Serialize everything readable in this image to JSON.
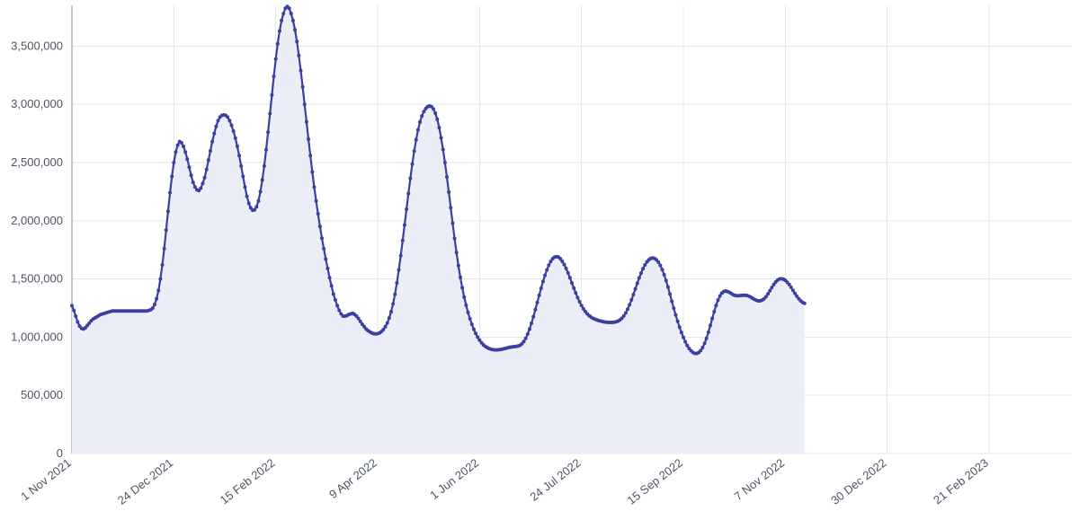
{
  "chart_data": {
    "type": "area",
    "title": "",
    "xlabel": "",
    "ylabel": "",
    "ylim": [
      0,
      3850000
    ],
    "y_ticks": [
      0,
      500000,
      1000000,
      1500000,
      2000000,
      2500000,
      3000000,
      3500000
    ],
    "y_tick_labels": [
      "0",
      "500,000",
      "1,000,000",
      "1,500,000",
      "2,000,000",
      "2,500,000",
      "3,000,000",
      "3,500,000"
    ],
    "x_tick_labels": [
      "1 Nov 2021",
      "24 Dec 2021",
      "15 Feb 2022",
      "9 Apr 2022",
      "1 Jun 2022",
      "24 Jul 2022",
      "15 Sep 2022",
      "7 Nov 2022",
      "30 Dec 2022",
      "21 Feb 2023"
    ],
    "x_tick_positions": [
      0,
      53,
      106,
      159,
      212,
      265,
      318,
      371,
      424,
      477
    ],
    "x_range": [
      0,
      520
    ],
    "line_color": "#3b3f9e",
    "fill_color": "#eceef7",
    "values": [
      1270000,
      1230000,
      1180000,
      1130000,
      1095000,
      1075000,
      1070000,
      1080000,
      1100000,
      1120000,
      1140000,
      1155000,
      1165000,
      1175000,
      1185000,
      1195000,
      1200000,
      1205000,
      1210000,
      1215000,
      1220000,
      1225000,
      1225000,
      1225000,
      1225000,
      1225000,
      1225000,
      1225000,
      1225000,
      1225000,
      1225000,
      1225000,
      1225000,
      1225000,
      1225000,
      1225000,
      1225000,
      1225000,
      1225000,
      1225000,
      1230000,
      1235000,
      1250000,
      1280000,
      1330000,
      1400000,
      1500000,
      1620000,
      1760000,
      1920000,
      2080000,
      2240000,
      2380000,
      2500000,
      2590000,
      2650000,
      2680000,
      2670000,
      2640000,
      2590000,
      2530000,
      2460000,
      2390000,
      2330000,
      2290000,
      2265000,
      2260000,
      2280000,
      2320000,
      2370000,
      2440000,
      2520000,
      2600000,
      2680000,
      2750000,
      2810000,
      2860000,
      2890000,
      2905000,
      2910000,
      2905000,
      2890000,
      2860000,
      2820000,
      2770000,
      2710000,
      2640000,
      2560000,
      2470000,
      2380000,
      2290000,
      2210000,
      2150000,
      2110000,
      2090000,
      2095000,
      2120000,
      2170000,
      2250000,
      2350000,
      2470000,
      2610000,
      2760000,
      2920000,
      3080000,
      3240000,
      3390000,
      3520000,
      3630000,
      3720000,
      3780000,
      3825000,
      3840000,
      3825000,
      3780000,
      3720000,
      3640000,
      3540000,
      3420000,
      3290000,
      3150000,
      3000000,
      2850000,
      2700000,
      2560000,
      2420000,
      2290000,
      2170000,
      2060000,
      1950000,
      1850000,
      1760000,
      1670000,
      1590000,
      1510000,
      1440000,
      1370000,
      1320000,
      1270000,
      1230000,
      1200000,
      1180000,
      1180000,
      1185000,
      1195000,
      1200000,
      1205000,
      1195000,
      1180000,
      1160000,
      1135000,
      1110000,
      1090000,
      1070000,
      1055000,
      1045000,
      1036000,
      1030000,
      1028000,
      1030000,
      1036000,
      1048000,
      1066000,
      1090000,
      1122000,
      1164000,
      1218000,
      1286000,
      1368000,
      1466000,
      1578000,
      1700000,
      1830000,
      1964000,
      2100000,
      2234000,
      2364000,
      2486000,
      2598000,
      2696000,
      2780000,
      2848000,
      2900000,
      2938000,
      2964000,
      2980000,
      2986000,
      2980000,
      2960000,
      2924000,
      2872000,
      2800000,
      2712000,
      2612000,
      2500000,
      2376000,
      2246000,
      2112000,
      1978000,
      1848000,
      1726000,
      1614000,
      1514000,
      1424000,
      1344000,
      1274000,
      1212000,
      1158000,
      1110000,
      1068000,
      1032000,
      1000000,
      974000,
      952000,
      934000,
      920000,
      910000,
      902000,
      896000,
      892000,
      890000,
      890000,
      892000,
      894000,
      898000,
      902000,
      906000,
      910000,
      914000,
      916000,
      918000,
      920000,
      924000,
      930000,
      942000,
      962000,
      990000,
      1026000,
      1070000,
      1120000,
      1176000,
      1236000,
      1298000,
      1360000,
      1420000,
      1478000,
      1532000,
      1578000,
      1618000,
      1650000,
      1674000,
      1688000,
      1692000,
      1688000,
      1674000,
      1652000,
      1624000,
      1590000,
      1552000,
      1510000,
      1466000,
      1422000,
      1380000,
      1340000,
      1304000,
      1272000,
      1244000,
      1220000,
      1200000,
      1184000,
      1172000,
      1162000,
      1154000,
      1148000,
      1142000,
      1138000,
      1134000,
      1130000,
      1128000,
      1126000,
      1126000,
      1126000,
      1128000,
      1132000,
      1138000,
      1148000,
      1162000,
      1182000,
      1208000,
      1240000,
      1278000,
      1320000,
      1366000,
      1414000,
      1462000,
      1508000,
      1550000,
      1588000,
      1620000,
      1646000,
      1664000,
      1676000,
      1680000,
      1676000,
      1664000,
      1644000,
      1616000,
      1580000,
      1536000,
      1486000,
      1430000,
      1370000,
      1308000,
      1248000,
      1190000,
      1136000,
      1086000,
      1040000,
      998000,
      960000,
      928000,
      902000,
      882000,
      868000,
      860000,
      860000,
      868000,
      884000,
      910000,
      946000,
      990000,
      1042000,
      1100000,
      1160000,
      1218000,
      1272000,
      1318000,
      1354000,
      1378000,
      1392000,
      1396000,
      1392000,
      1384000,
      1374000,
      1364000,
      1358000,
      1356000,
      1356000,
      1358000,
      1360000,
      1360000,
      1358000,
      1352000,
      1344000,
      1334000,
      1324000,
      1316000,
      1312000,
      1312000,
      1318000,
      1330000,
      1348000,
      1372000,
      1398000,
      1426000,
      1452000,
      1474000,
      1490000,
      1500000,
      1502000,
      1498000,
      1488000,
      1472000,
      1452000,
      1428000,
      1402000,
      1376000,
      1352000,
      1330000,
      1312000,
      1298000,
      1290000
    ]
  }
}
